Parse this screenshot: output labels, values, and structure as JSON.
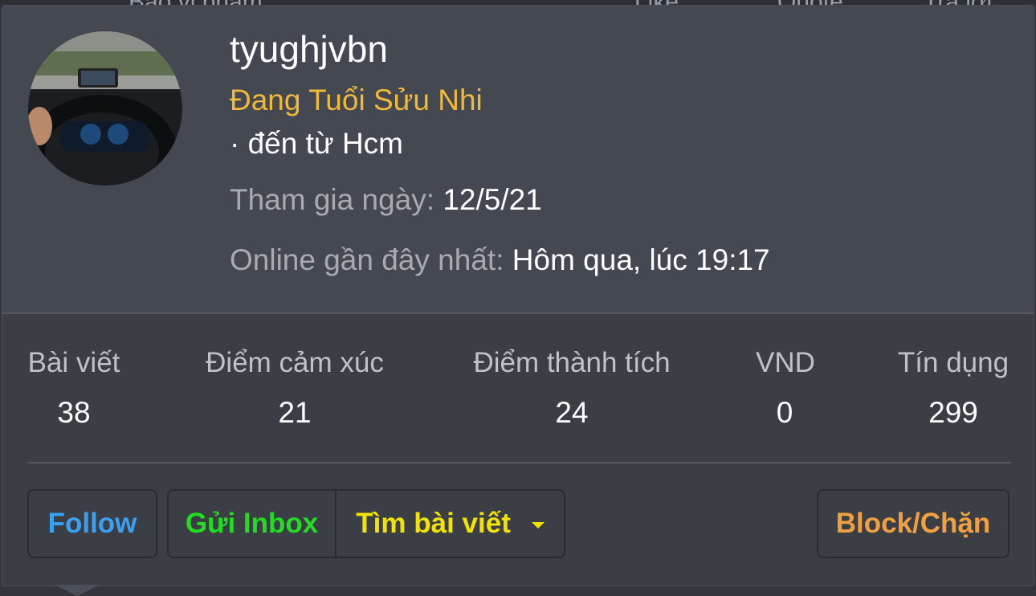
{
  "background_bar": {
    "items": [
      "Báo vi phạm",
      "Like",
      "Quote",
      "Trả lời"
    ]
  },
  "profile": {
    "name": "tyughjvbn",
    "title": "Đang Tuổi Sửu Nhi",
    "location": "· đến từ Hcm",
    "joined_label": "Tham gia ngày:",
    "joined_value": "12/5/21",
    "last_online_label": "Online gần đây nhất:",
    "last_online_value": "Hôm qua, lúc 19:17",
    "avatar_icon": "avatar-car-dashboard-photo"
  },
  "stats": [
    {
      "label": "Bài viết",
      "value": "38"
    },
    {
      "label": "Điểm cảm xúc",
      "value": "21"
    },
    {
      "label": "Điểm thành tích",
      "value": "24"
    },
    {
      "label": "VND",
      "value": "0"
    },
    {
      "label": "Tín dụng",
      "value": "299"
    }
  ],
  "actions": {
    "follow": "Follow",
    "inbox": "Gửi Inbox",
    "find_posts": "Tìm bài viết",
    "block": "Block/Chặn"
  },
  "colors": {
    "card_top": "#444851",
    "card_bottom": "#3b3e45",
    "title": "#f0b93a",
    "follow": "#3aa0f0",
    "inbox": "#22dd22",
    "find_posts": "#f2e200",
    "block": "#f0a040"
  }
}
